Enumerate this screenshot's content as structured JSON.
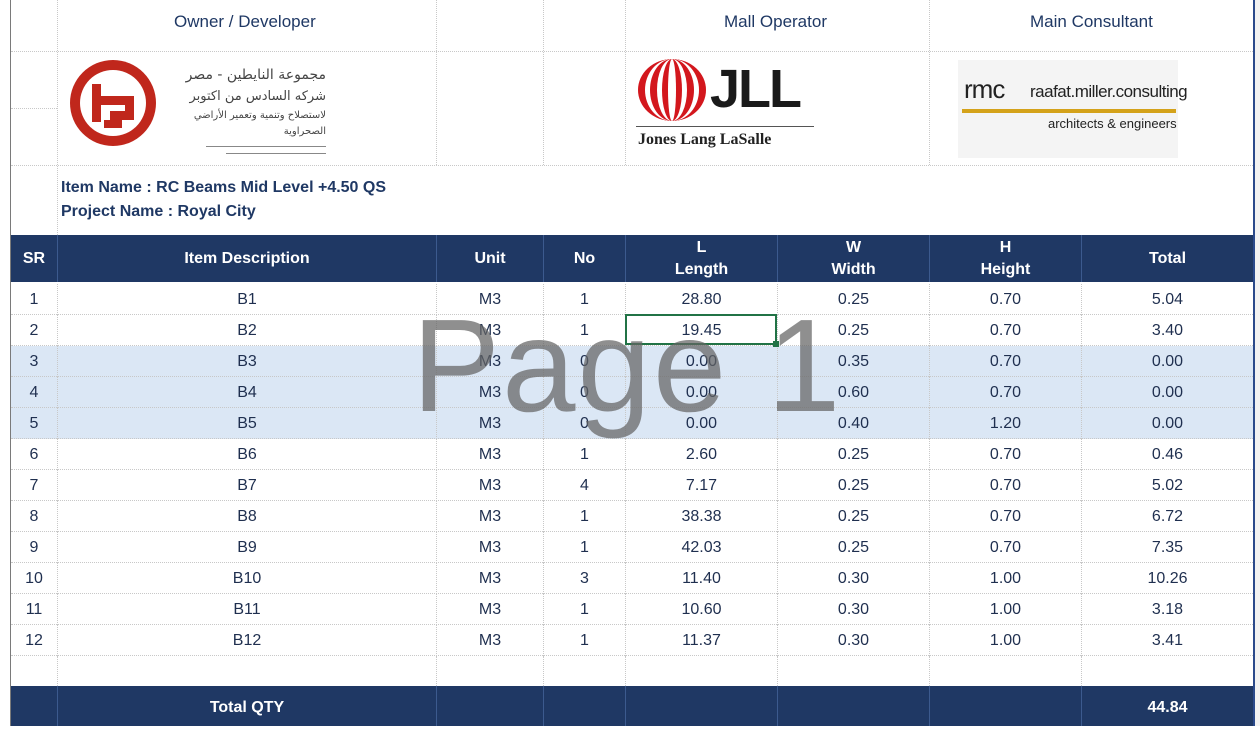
{
  "header": {
    "owner_label": "Owner / Developer",
    "operator_label": "Mall Operator",
    "consultant_label": "Main Consultant"
  },
  "logos": {
    "owner": {
      "arabic_line1": "مجموعة النايطين - مصر",
      "arabic_line2": "شركه السادس من اكتوبر",
      "arabic_line3": "لاستصلاح وتنمية وتعمير الأراضي الصحراوية"
    },
    "operator": {
      "brand": "JLL",
      "subtitle": "Jones Lang LaSalle"
    },
    "consultant": {
      "short": "rmc",
      "name": "raafat.miller.consulting",
      "tagline": "architects & engineers"
    }
  },
  "info": {
    "item_name": "Item Name : RC Beams Mid Level +4.50  QS",
    "project_name": "Project Name : Royal City"
  },
  "columns": {
    "sr": "SR",
    "desc": "Item Description",
    "unit": "Unit",
    "no": "No",
    "l_abbr": "L",
    "l_name": "Length",
    "w_abbr": "W",
    "w_name": "Width",
    "h_abbr": "H",
    "h_name": "Height",
    "total": "Total"
  },
  "rows": [
    {
      "sr": "1",
      "desc": "B1",
      "unit": "M3",
      "no": "1",
      "l": "28.80",
      "w": "0.25",
      "h": "0.70",
      "total": "5.04"
    },
    {
      "sr": "2",
      "desc": "B2",
      "unit": "M3",
      "no": "1",
      "l": "19.45",
      "w": "0.25",
      "h": "0.70",
      "total": "3.40"
    },
    {
      "sr": "3",
      "desc": "B3",
      "unit": "M3",
      "no": "0",
      "l": "0.00",
      "w": "0.35",
      "h": "0.70",
      "total": "0.00"
    },
    {
      "sr": "4",
      "desc": "B4",
      "unit": "M3",
      "no": "0",
      "l": "0.00",
      "w": "0.60",
      "h": "0.70",
      "total": "0.00"
    },
    {
      "sr": "5",
      "desc": "B5",
      "unit": "M3",
      "no": "0",
      "l": "0.00",
      "w": "0.40",
      "h": "1.20",
      "total": "0.00"
    },
    {
      "sr": "6",
      "desc": "B6",
      "unit": "M3",
      "no": "1",
      "l": "2.60",
      "w": "0.25",
      "h": "0.70",
      "total": "0.46"
    },
    {
      "sr": "7",
      "desc": "B7",
      "unit": "M3",
      "no": "4",
      "l": "7.17",
      "w": "0.25",
      "h": "0.70",
      "total": "5.02"
    },
    {
      "sr": "8",
      "desc": "B8",
      "unit": "M3",
      "no": "1",
      "l": "38.38",
      "w": "0.25",
      "h": "0.70",
      "total": "6.72"
    },
    {
      "sr": "9",
      "desc": "B9",
      "unit": "M3",
      "no": "1",
      "l": "42.03",
      "w": "0.25",
      "h": "0.70",
      "total": "7.35"
    },
    {
      "sr": "10",
      "desc": "B10",
      "unit": "M3",
      "no": "3",
      "l": "11.40",
      "w": "0.30",
      "h": "1.00",
      "total": "10.26"
    },
    {
      "sr": "11",
      "desc": "B11",
      "unit": "M3",
      "no": "1",
      "l": "10.60",
      "w": "0.30",
      "h": "1.00",
      "total": "3.18"
    },
    {
      "sr": "12",
      "desc": "B12",
      "unit": "M3",
      "no": "1",
      "l": "11.37",
      "w": "0.30",
      "h": "1.00",
      "total": "3.41"
    }
  ],
  "footer": {
    "label": "Total QTY",
    "total": "44.84"
  },
  "watermark": "Page 1",
  "colors": {
    "header_bg": "#1f3864",
    "highlight_row": "#dbe7f5",
    "selection": "#217346",
    "text": "#1f3864"
  }
}
